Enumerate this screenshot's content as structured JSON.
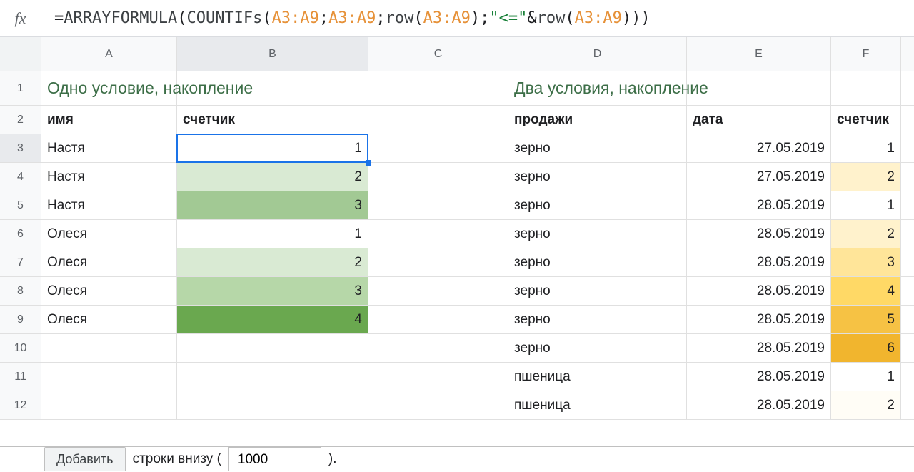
{
  "formula": {
    "parts": [
      {
        "t": "=",
        "c": "tok-black"
      },
      {
        "t": "ARRAYFORMULA",
        "c": "tok-gray"
      },
      {
        "t": "(",
        "c": "tok-black"
      },
      {
        "t": "COUNTIFs",
        "c": "tok-gray"
      },
      {
        "t": "(",
        "c": "tok-black"
      },
      {
        "t": "A3:A9",
        "c": "tok-orange"
      },
      {
        "t": ";",
        "c": "tok-black"
      },
      {
        "t": "A3:A9",
        "c": "tok-orange"
      },
      {
        "t": ";",
        "c": "tok-black"
      },
      {
        "t": "row",
        "c": "tok-gray"
      },
      {
        "t": "(",
        "c": "tok-black"
      },
      {
        "t": "A3:A9",
        "c": "tok-orange"
      },
      {
        "t": ")",
        "c": "tok-black"
      },
      {
        "t": ";",
        "c": "tok-black"
      },
      {
        "t": "\"<=\"",
        "c": "tok-green"
      },
      {
        "t": "&",
        "c": "tok-black"
      },
      {
        "t": "row",
        "c": "tok-gray"
      },
      {
        "t": "(",
        "c": "tok-black"
      },
      {
        "t": "A3:A9",
        "c": "tok-orange"
      },
      {
        "t": ")))",
        "c": "tok-black"
      }
    ]
  },
  "columns": [
    "A",
    "B",
    "C",
    "D",
    "E",
    "F",
    ""
  ],
  "row_numbers": [
    "1",
    "2",
    "3",
    "4",
    "5",
    "6",
    "7",
    "8",
    "9",
    "10",
    "11",
    "12"
  ],
  "data": {
    "title_left": "Одно условие, накопление",
    "title_right": "Два условия, накопление",
    "h_name": "имя",
    "h_counter": "счетчик",
    "h_sales": "продажи",
    "h_date": "дата",
    "h_counter2": "счетчик",
    "left_rows": [
      {
        "name": "Настя",
        "cnt": "1",
        "cls": ""
      },
      {
        "name": "Настя",
        "cnt": "2",
        "cls": "g1"
      },
      {
        "name": "Настя",
        "cnt": "3",
        "cls": "g3"
      },
      {
        "name": "Олеся",
        "cnt": "1",
        "cls": ""
      },
      {
        "name": "Олеся",
        "cnt": "2",
        "cls": "g1"
      },
      {
        "name": "Олеся",
        "cnt": "3",
        "cls": "g2"
      },
      {
        "name": "Олеся",
        "cnt": "4",
        "cls": "g5"
      }
    ],
    "right_rows": [
      {
        "sales": "зерно",
        "date": "27.05.2019",
        "cnt": "1",
        "cls": ""
      },
      {
        "sales": "зерно",
        "date": "27.05.2019",
        "cnt": "2",
        "cls": "y1"
      },
      {
        "sales": "зерно",
        "date": "28.05.2019",
        "cnt": "1",
        "cls": ""
      },
      {
        "sales": "зерно",
        "date": "28.05.2019",
        "cnt": "2",
        "cls": "y1"
      },
      {
        "sales": "зерно",
        "date": "28.05.2019",
        "cnt": "3",
        "cls": "y2"
      },
      {
        "sales": "зерно",
        "date": "28.05.2019",
        "cnt": "4",
        "cls": "y3"
      },
      {
        "sales": "зерно",
        "date": "28.05.2019",
        "cnt": "5",
        "cls": "y4"
      },
      {
        "sales": "зерно",
        "date": "28.05.2019",
        "cnt": "6",
        "cls": "y5"
      },
      {
        "sales": "пшеница",
        "date": "28.05.2019",
        "cnt": "1",
        "cls": ""
      },
      {
        "sales": "пшеница",
        "date": "28.05.2019",
        "cnt": "2",
        "cls": "y0"
      }
    ]
  },
  "footer": {
    "add_label": "Добавить",
    "rows_text_before": "строки внизу (",
    "rows_input_value": "1000",
    "rows_text_after": ")."
  },
  "active_cell": {
    "row": 3,
    "col": "B"
  }
}
